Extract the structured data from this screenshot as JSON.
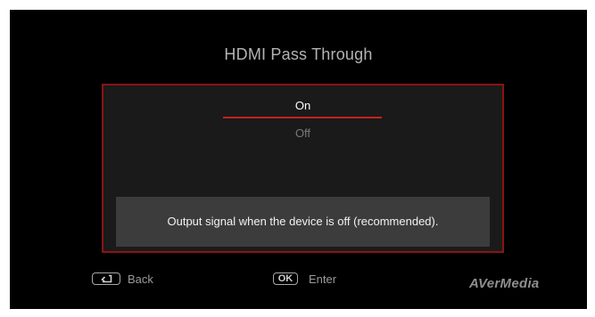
{
  "menu": {
    "title": "HDMI Pass Through",
    "options": [
      {
        "label": "On",
        "selected": true
      },
      {
        "label": "Off",
        "selected": false
      }
    ],
    "hint": "Output signal when the device is off (recommended)."
  },
  "footer": {
    "back": {
      "icon": "return-icon",
      "label": "Back"
    },
    "enter": {
      "key": "OK",
      "label": "Enter"
    }
  },
  "brand": {
    "logo_text": "AVerMedia"
  },
  "colors": {
    "background": "#000000",
    "panel": "#1a1a1a",
    "accent": "#c8201f",
    "panel_border": "#8a1414",
    "hint_box": "#3c3c3c"
  }
}
